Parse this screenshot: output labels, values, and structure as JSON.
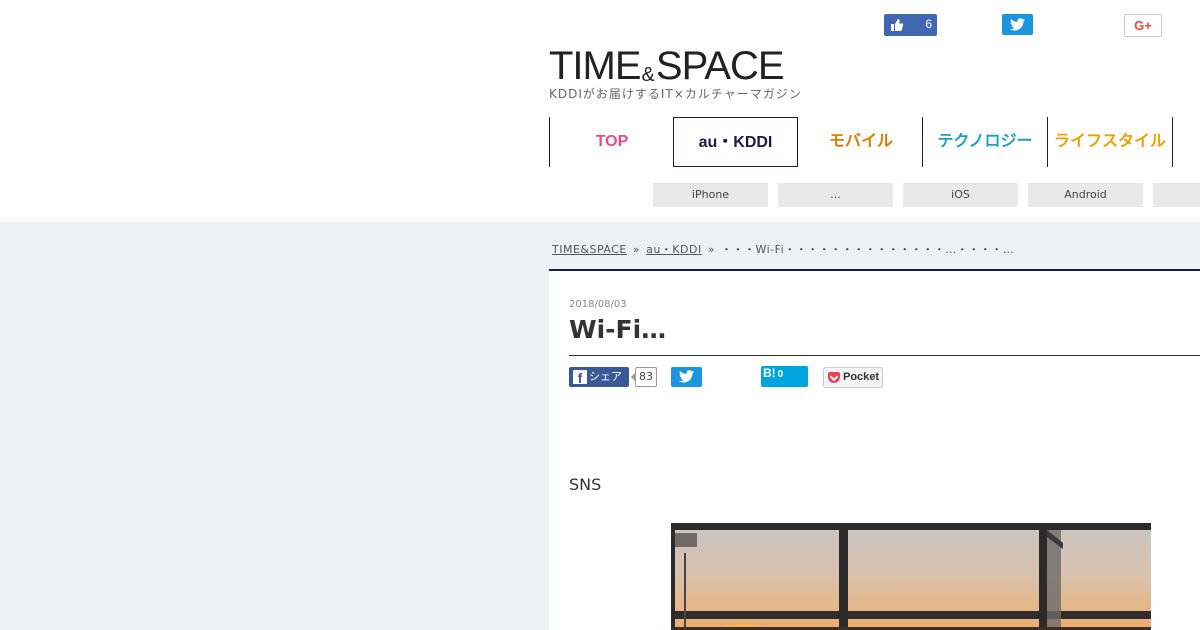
{
  "header": {
    "logo": {
      "title_left": "TIME",
      "title_amp": "&",
      "title_right": "SPACE",
      "tagline": "KDDIがお届けするIT×カルチャーマガジン"
    },
    "social": {
      "facebook_like_count": "6",
      "googleplus_label": "G+"
    }
  },
  "nav": {
    "items": [
      {
        "label": "TOP",
        "color": "#e64b8b"
      },
      {
        "label": "au・KDDI",
        "color": "#1a1c45"
      },
      {
        "label": "モバイル",
        "color": "#e07b00"
      },
      {
        "label": "テクノロジー",
        "color": "#1aa0c8"
      },
      {
        "label": "ライフスタイル",
        "color": "#f0a000"
      },
      {
        "label": "",
        "color": "#1aa0c8"
      }
    ],
    "active": "au・KDDI",
    "sub_items": [
      "iPhone",
      "...",
      "iOS",
      "Android",
      ""
    ]
  },
  "breadcrumb": {
    "items": [
      "TIME&SPACE",
      "au・KDDI"
    ],
    "current": "・・・Wi-Fi・・・・・・・・・・・・・・…・・・・…"
  },
  "article": {
    "date": "2018/08/03",
    "title": "Wi-Fi…",
    "share": {
      "facebook_label": "シェア",
      "facebook_count": "83",
      "hatena_label": "B!",
      "hatena_count": "0",
      "pocket_label": "Pocket"
    },
    "body_text": "SNS"
  },
  "colors": {
    "accent_navy": "#1a1c45",
    "page_background": "#eef0f4"
  }
}
